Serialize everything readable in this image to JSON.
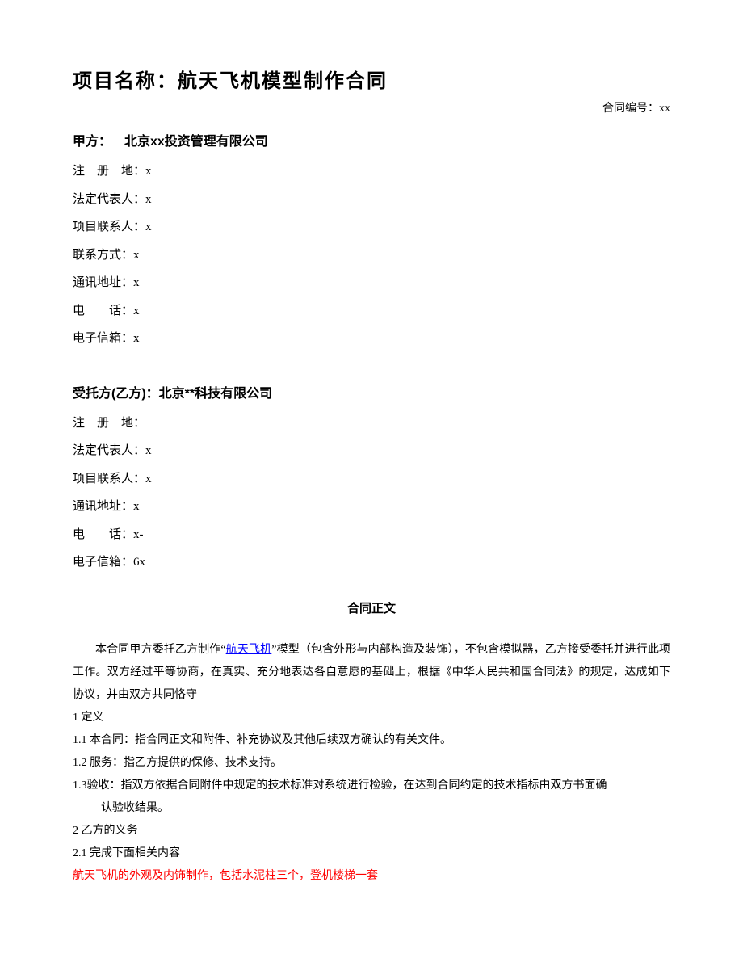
{
  "header": {
    "title": "项目名称：航天飞机模型制作合同",
    "contract_no_label": "合同编号：",
    "contract_no_value": "xx"
  },
  "partyA": {
    "header": "甲方： 北京xx投资管理有限公司",
    "fields": {
      "reg_addr": "注 册 地：x",
      "legal_rep": "法定代表人：x",
      "proj_contact": "项目联系人：x",
      "contact_method": "联系方式：x",
      "mail_addr": "通讯地址：x",
      "phone": "电　　话：x",
      "email": "电子信箱：x"
    }
  },
  "partyB": {
    "header": "受托方(乙方)：北京**科技有限公司",
    "fields": {
      "reg_addr": "注 册 地：",
      "legal_rep": "法定代表人：x",
      "proj_contact": "项目联系人：x",
      "mail_addr": "通讯地址：x",
      "phone": "电　　话：x-",
      "email": "电子信箱：6x"
    }
  },
  "body": {
    "title": "合同正文",
    "intro_pre": "本合同甲方委托乙方制作“",
    "intro_link": "航天飞机",
    "intro_post": "”模型（包含外形与内部构造及装饰），不包含模拟器，乙方接受委托并进行此项工作。双方经过平等协商，在真实、充分地表达各自意愿的基础上，根据《中华人民共和国合同法》的规定，达成如下协议，并由双方共同恪守",
    "c1": "1 定义",
    "c1_1": "1.1 本合同：指合同正文和附件、补充协议及其他后续双方确认的有关文件。",
    "c1_2": "1.2 服务：指乙方提供的保修、技术支持。",
    "c1_3a": "1.3验收：指双方依据合同附件中规定的技术标准对系统进行检验，在达到合同约定的技术指标由双方书面确",
    "c1_3b": "认验收结果。",
    "c2": "2 乙方的义务",
    "c2_1": "2.1 完成下面相关内容",
    "c2_red": "航天飞机的外观及内饰制作，包括水泥柱三个，登机楼梯一套"
  }
}
